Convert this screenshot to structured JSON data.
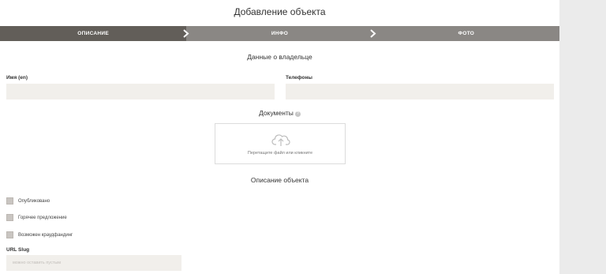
{
  "header": {
    "title": "Добавление объекта"
  },
  "steps": [
    {
      "label": "ОПИСАНИЕ"
    },
    {
      "label": "ИНФО"
    },
    {
      "label": "ФОТО"
    }
  ],
  "owner_section": {
    "title": "Данные о владельце",
    "name_label": "Имя (en)",
    "phones_label": "Телефоны",
    "documents_title": "Документы",
    "dropzone_hint": "Перетащите файл или кликните"
  },
  "object_section": {
    "title": "Описание объекта",
    "checkboxes": [
      {
        "label": "Опубликовано"
      },
      {
        "label": "Горячее предложение"
      },
      {
        "label": "Возможен краудфандинг"
      }
    ],
    "slug_label": "URL Slug",
    "slug_placeholder": "можно оставить пустым"
  },
  "colors": {
    "step_active": "#625e59",
    "step_inactive": "#8a8784",
    "input_bg": "#f1efeb",
    "checkbox": "#c9c5c1"
  },
  "icons": [
    "chevron-right-icon",
    "help-icon",
    "cloud-upload-icon"
  ]
}
